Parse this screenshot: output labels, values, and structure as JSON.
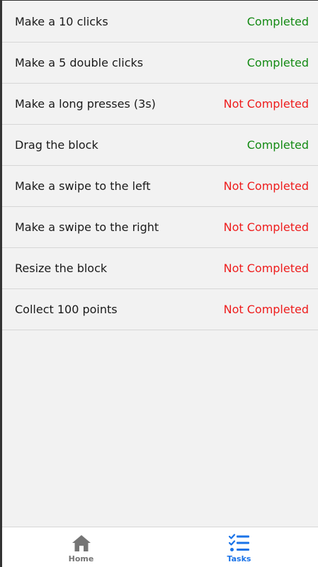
{
  "tasks": [
    {
      "label": "Make a 10 clicks",
      "status": "Completed",
      "done": true
    },
    {
      "label": "Make a 5 double clicks",
      "status": "Completed",
      "done": true
    },
    {
      "label": "Make a long presses (3s)",
      "status": "Not Completed",
      "done": false
    },
    {
      "label": "Drag the block",
      "status": "Completed",
      "done": true
    },
    {
      "label": "Make a swipe to the left",
      "status": "Not Completed",
      "done": false
    },
    {
      "label": "Make a swipe to the right",
      "status": "Not Completed",
      "done": false
    },
    {
      "label": "Resize the block",
      "status": "Not Completed",
      "done": false
    },
    {
      "label": "Collect 100 points",
      "status": "Not Completed",
      "done": false
    }
  ],
  "tabs": [
    {
      "label": "Home",
      "icon": "home-icon",
      "active": false
    },
    {
      "label": "Tasks",
      "icon": "checklist-icon",
      "active": true
    }
  ],
  "colors": {
    "completed": "#138a13",
    "not_completed": "#ee1c1c",
    "tab_active": "#1a73e8",
    "tab_inactive": "#757575"
  }
}
